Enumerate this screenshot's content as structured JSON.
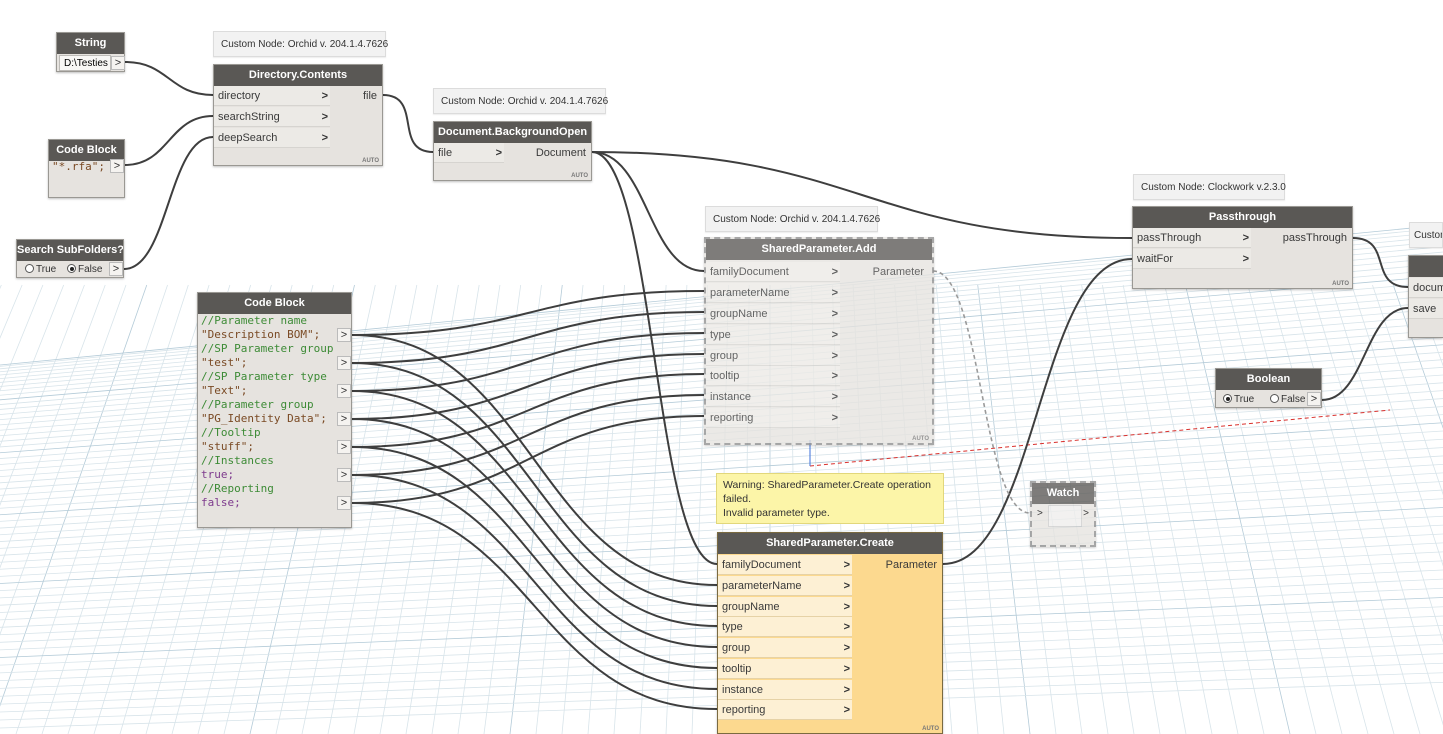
{
  "string_node": {
    "title": "String",
    "value": "D:\\Testies"
  },
  "code_block_small": {
    "title": "Code Block",
    "code": "\"*.rfa\";"
  },
  "search_subfolders": {
    "title": "Search SubFolders?",
    "option_true": "True",
    "option_false": "False",
    "selected": "False"
  },
  "directory_contents": {
    "tag": "Custom Node: Orchid v. 204.1.4.7626",
    "title": "Directory.Contents",
    "inputs": [
      "directory",
      "searchString",
      "deepSearch"
    ],
    "output": "file",
    "mode": "AUTO"
  },
  "background_open": {
    "tag": "Custom Node: Orchid v. 204.1.4.7626",
    "title": "Document.BackgroundOpen",
    "inputs": [
      "file"
    ],
    "output": "Document",
    "mode": "AUTO"
  },
  "shared_param_add": {
    "tag": "Custom Node: Orchid v. 204.1.4.7626",
    "title": "SharedParameter.Add",
    "inputs": [
      "familyDocument",
      "parameterName",
      "groupName",
      "type",
      "group",
      "tooltip",
      "instance",
      "reporting"
    ],
    "output": "Parameter",
    "mode": "AUTO"
  },
  "shared_param_create": {
    "title": "SharedParameter.Create",
    "inputs": [
      "familyDocument",
      "parameterName",
      "groupName",
      "type",
      "group",
      "tooltip",
      "instance",
      "reporting"
    ],
    "output": "Parameter",
    "mode": "AUTO",
    "warning_line1": "Warning: SharedParameter.Create operation",
    "warning_line2": "failed.",
    "warning_line3": "Invalid parameter type."
  },
  "code_block_big": {
    "title": "Code Block",
    "lines": [
      {
        "text": "//Parameter name",
        "kind": "comment"
      },
      {
        "text": "\"Description BOM\";",
        "kind": "string"
      },
      {
        "text": "//SP Parameter group",
        "kind": "comment"
      },
      {
        "text": "\"test\";",
        "kind": "string"
      },
      {
        "text": "//SP Parameter type",
        "kind": "comment"
      },
      {
        "text": "\"Text\";",
        "kind": "string"
      },
      {
        "text": "//Parameter group",
        "kind": "comment"
      },
      {
        "text": "\"PG_Identity Data\";",
        "kind": "string"
      },
      {
        "text": "//Tooltip",
        "kind": "comment"
      },
      {
        "text": "\"stuff\";",
        "kind": "string"
      },
      {
        "text": "//Instances",
        "kind": "comment"
      },
      {
        "text": "true;",
        "kind": "keyword"
      },
      {
        "text": "//Reporting",
        "kind": "comment"
      },
      {
        "text": "false;",
        "kind": "keyword"
      }
    ]
  },
  "passthrough": {
    "tag": "Custom Node: Clockwork v.2.3.0",
    "title": "Passthrough",
    "inputs": [
      "passThrough",
      "waitFor"
    ],
    "output": "passThrough",
    "mode": "AUTO"
  },
  "boolean_node": {
    "title": "Boolean",
    "option_true": "True",
    "option_false": "False",
    "selected": "True"
  },
  "watch_node": {
    "title": "Watch"
  },
  "partial_node": {
    "tag": "Custom",
    "inputs": [
      "docum",
      "save"
    ]
  },
  "colors": {
    "wire": "#3e3e3e",
    "node_title": "#5a5855",
    "node_body": "#e6e3df",
    "warning_body": "#fcd98f",
    "tooltip": "#fcf5a8",
    "comment": "#3d8b36",
    "string": "#7a4a24",
    "keyword": "#7d3a8d"
  }
}
